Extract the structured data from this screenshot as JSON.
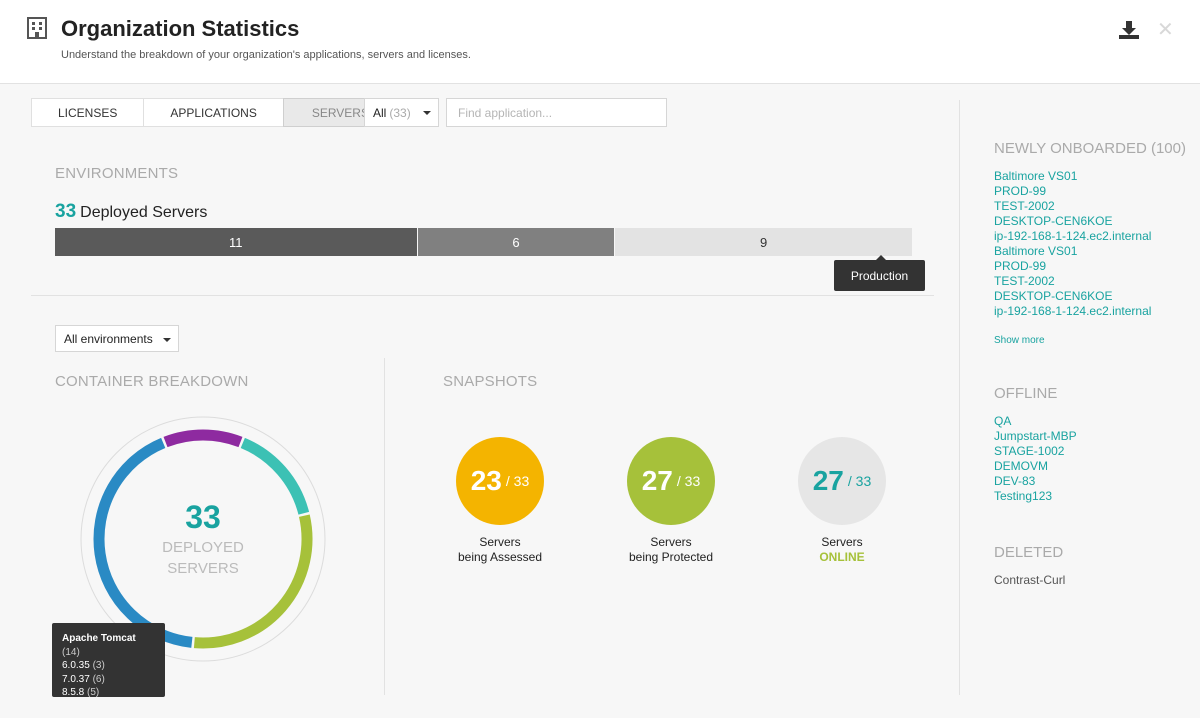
{
  "header": {
    "title": "Organization Statistics",
    "subtitle": "Understand the breakdown of your organization's applications, servers and licenses.",
    "close_glyph": "✕"
  },
  "tabs": [
    {
      "label": "LICENSES",
      "active": false
    },
    {
      "label": "APPLICATIONS",
      "active": false
    },
    {
      "label": "SERVERS",
      "active": true
    }
  ],
  "filter": {
    "selected": "All",
    "count": "(33)"
  },
  "search": {
    "placeholder": "Find application..."
  },
  "environments": {
    "section_label": "ENVIRONMENTS",
    "deployed_count": "33",
    "deployed_label": "Deployed Servers",
    "segments": [
      {
        "value": 11,
        "label": "11",
        "color": "#5a5a5a",
        "text_color": "#ffffff"
      },
      {
        "value": 6,
        "label": "6",
        "color": "#808080",
        "text_color": "#ffffff"
      },
      {
        "value": 9,
        "label": "9",
        "color": "#e3e3e3",
        "text_color": "#333333"
      }
    ],
    "tooltip": "Production"
  },
  "env_select": {
    "selected": "All environments"
  },
  "container": {
    "section_label": "CONTAINER BREAKDOWN",
    "center_num": "33",
    "center_line1": "DEPLOYED",
    "center_line2": "SERVERS",
    "slices": [
      {
        "name": "purple",
        "color": "#8e2aa0",
        "value": 4
      },
      {
        "name": "teal",
        "color": "#3cc1b4",
        "value": 5
      },
      {
        "name": "green",
        "color": "#a6c13a",
        "value": 10
      },
      {
        "name": "Apache Tomcat",
        "color": "#2a8ac4",
        "value": 14
      }
    ],
    "tooltip": {
      "name": "Apache Tomcat",
      "count": "(14)",
      "items": [
        {
          "version": "6.0.35",
          "count": "(3)"
        },
        {
          "version": "7.0.37",
          "count": "(6)"
        },
        {
          "version": "8.5.8",
          "count": "(5)"
        }
      ]
    }
  },
  "snapshots": {
    "section_label": "SNAPSHOTS",
    "items": [
      {
        "value": "23",
        "total": "/ 33",
        "color": "#f4b400",
        "text_color": "#ffffff",
        "line1": "Servers",
        "line2": "being Assessed"
      },
      {
        "value": "27",
        "total": "/ 33",
        "color": "#a6c13a",
        "text_color": "#ffffff",
        "line1": "Servers",
        "line2": "being Protected"
      },
      {
        "value": "27",
        "total": "/ 33",
        "color": "#e6e6e6",
        "text_color": "#19a3a0",
        "line1": "Servers",
        "line2": "ONLINE"
      }
    ]
  },
  "right_panel": {
    "newly_label": "NEWLY ONBOARDED (100)",
    "newly_items": [
      "Baltimore VS01",
      "PROD-99",
      "TEST-2002",
      "DESKTOP-CEN6KOE",
      "ip-192-168-1-124.ec2.internal",
      "Baltimore VS01",
      "PROD-99",
      "TEST-2002",
      "DESKTOP-CEN6KOE",
      "ip-192-168-1-124.ec2.internal"
    ],
    "show_more": "Show more",
    "offline_label": "OFFLINE",
    "offline_items": [
      "QA",
      "Jumpstart-MBP",
      "STAGE-1002",
      "DEMOVM",
      "DEV-83",
      "Testing123"
    ],
    "deleted_label": "DELETED",
    "deleted_items": [
      "Contrast-Curl"
    ]
  }
}
